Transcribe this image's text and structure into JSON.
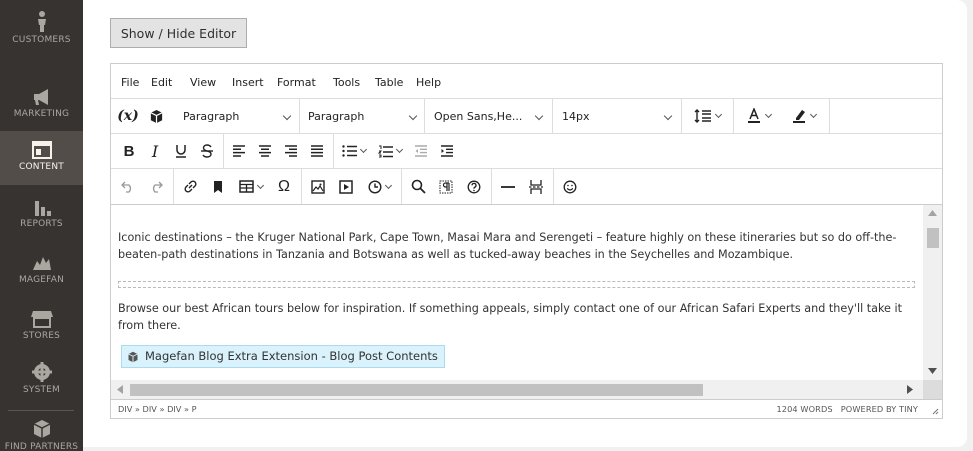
{
  "sidebar": {
    "items": [
      {
        "label": "CUSTOMERS",
        "icon": "person-icon"
      },
      {
        "label": "MARKETING",
        "icon": "megaphone-icon"
      },
      {
        "label": "CONTENT",
        "icon": "layout-icon",
        "active": true
      },
      {
        "label": "REPORTS",
        "icon": "bar-chart-icon"
      },
      {
        "label": "MAGEFAN",
        "icon": "magefan-icon"
      },
      {
        "label": "STORES",
        "icon": "store-icon"
      },
      {
        "label": "SYSTEM",
        "icon": "gear-icon"
      },
      {
        "label": "FIND PARTNERS",
        "icon": "cube-icon"
      }
    ]
  },
  "toolbar": {
    "toggle_editor_label": "Show / Hide Editor"
  },
  "editor": {
    "menu": [
      "File",
      "Edit",
      "View",
      "Insert",
      "Format",
      "Tools",
      "Table",
      "Help"
    ],
    "block_format": "Paragraph",
    "style_format": "Paragraph",
    "font_family": "Open Sans,He...",
    "font_size": "14px",
    "variable_label": "(x)",
    "content": {
      "p1": "Iconic destinations – the Kruger National Park, Cape Town, Masai Mara and Serengeti – feature highly on these itineraries but so do off-the-beaten-path destinations in Tanzania and Botswana as well as tucked-away beaches in the Seychelles and Mozambique.",
      "p2": "Browse our best African tours below for inspiration. If something appeals, simply contact one of our African Safari Experts and they'll take it from there.",
      "widget": "Magefan Blog Extra Extension - Blog Post Contents"
    },
    "status": {
      "path": "DIV » DIV » DIV » P",
      "word_count": "1204 WORDS",
      "powered_by": "POWERED BY TINY"
    }
  },
  "colors": {
    "sidebar_bg": "#373330",
    "sidebar_active_bg": "#524d49",
    "widget_bg": "#d9f2fb"
  }
}
